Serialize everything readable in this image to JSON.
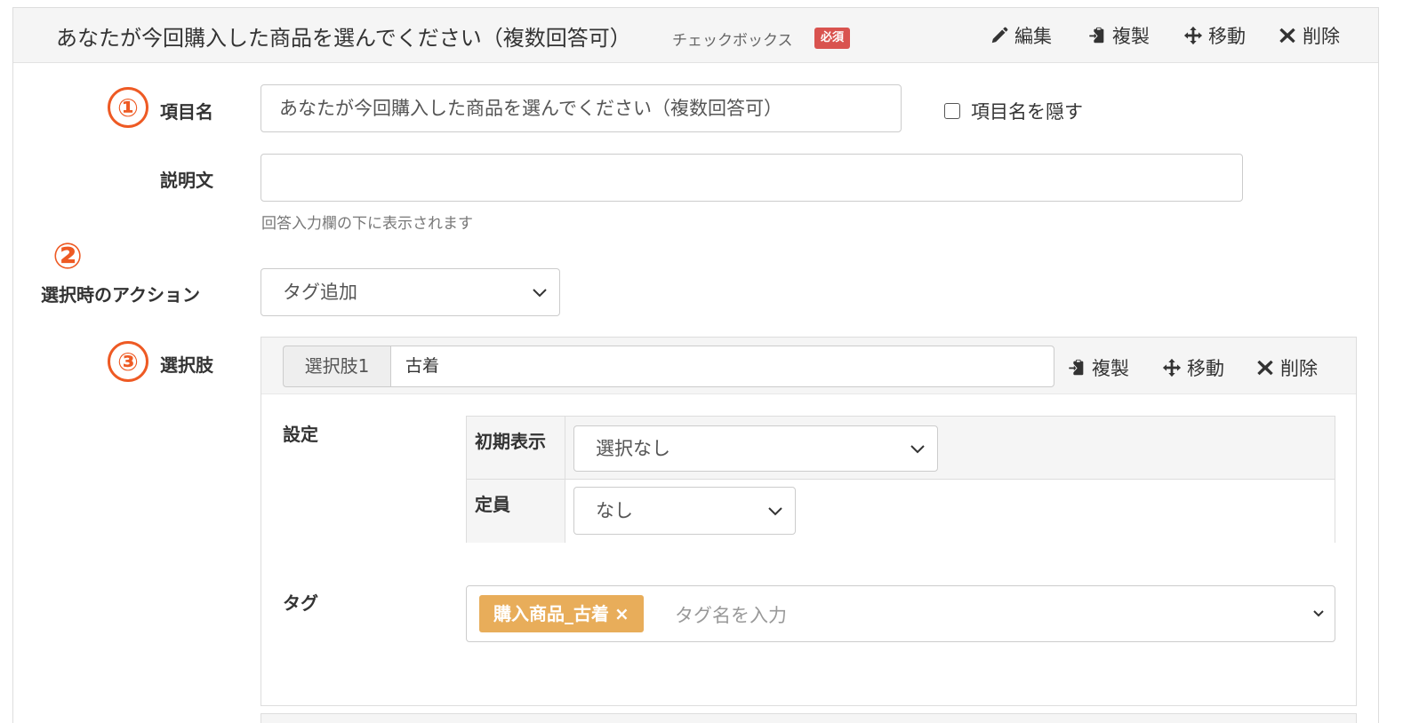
{
  "header": {
    "title": "あなたが今回購入した商品を選んでください（複数回答可）",
    "type_label": "チェックボックス",
    "required_badge": "必須",
    "actions": {
      "edit": "編集",
      "duplicate": "複製",
      "move": "移動",
      "delete": "削除"
    }
  },
  "markers": {
    "one": "①",
    "two": "②",
    "three": "③"
  },
  "fields": {
    "item_name": {
      "label": "項目名",
      "value": "あなたが今回購入した商品を選んでください（複数回答可）",
      "hide_label": "項目名を隠す"
    },
    "description": {
      "label": "説明文",
      "value": "",
      "help": "回答入力欄の下に表示されます"
    },
    "action": {
      "label": "選択時のアクション",
      "selected": "タグ追加"
    },
    "options": {
      "label": "選択肢"
    }
  },
  "option": {
    "addon": "選択肢1",
    "value": "古着",
    "actions": {
      "duplicate": "複製",
      "move": "移動",
      "delete": "削除"
    },
    "settings_label": "設定",
    "initial_display": {
      "label": "初期表示",
      "selected": "選択なし"
    },
    "capacity": {
      "label": "定員",
      "selected": "なし"
    },
    "tag": {
      "label": "タグ",
      "chip": "購入商品_古着",
      "chip_remove": "×",
      "placeholder": "タグ名を入力"
    }
  },
  "colors": {
    "marker": "#ee5a24",
    "required_badge": "#d9534f",
    "tag_chip": "#e8ad5a",
    "header_bg": "#f5f5f5"
  },
  "icons": {
    "edit": "pencil-icon",
    "duplicate": "clipboard-copy-icon",
    "move": "move-arrows-icon",
    "delete": "x-icon",
    "select": "chevron-down-icon"
  }
}
